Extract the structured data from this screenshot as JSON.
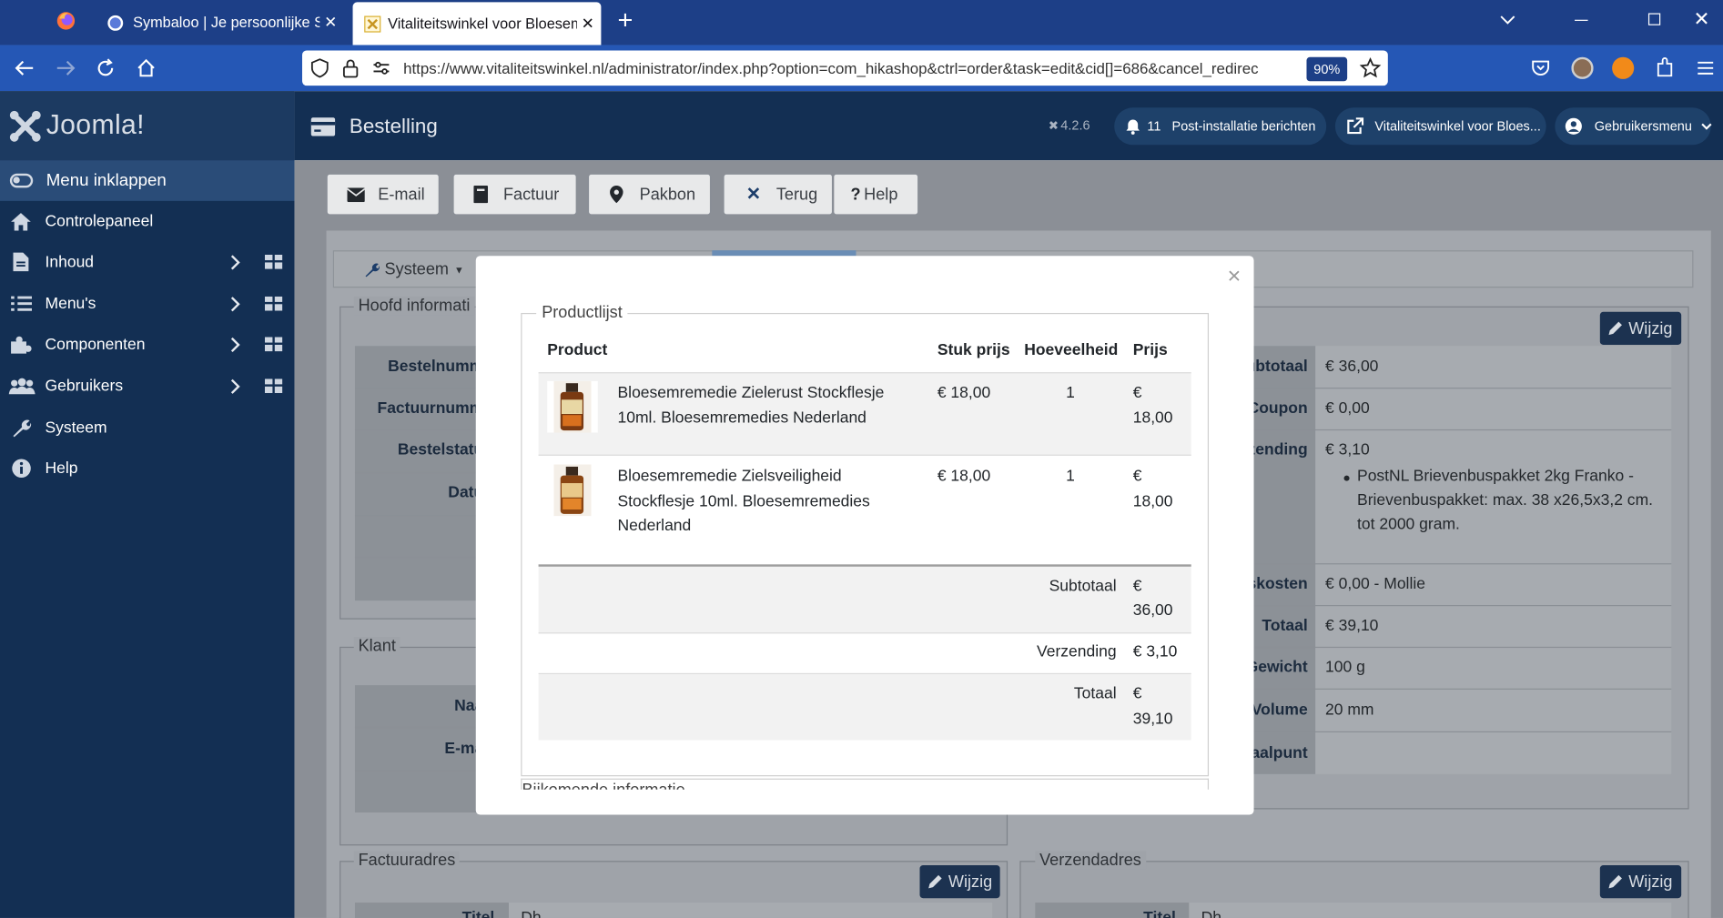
{
  "browser": {
    "tabs": [
      {
        "label": "Symbaloo | Je persoonlijke Start"
      },
      {
        "label": "Vitaliteitswinkel voor Bloesemre"
      }
    ],
    "url": "https://www.vitaliteitswinkel.nl/administrator/index.php?option=com_hikashop&ctrl=order&task=edit&cid[]=686&cancel_redirec",
    "zoom": "90%"
  },
  "joomla": {
    "brand": "Joomla!",
    "page_title": "Bestelling",
    "version": "4.2.6",
    "post_install_count": "11",
    "post_install_label": "Post-installatie berichten",
    "site_link": "Vitaliteitswinkel voor Bloes...",
    "user_menu": "Gebruikersmenu"
  },
  "sidebar": {
    "collapse": "Menu inklappen",
    "items": [
      {
        "label": "Controlepaneel"
      },
      {
        "label": "Inhoud"
      },
      {
        "label": "Menu's"
      },
      {
        "label": "Componenten"
      },
      {
        "label": "Gebruikers"
      },
      {
        "label": "Systeem"
      },
      {
        "label": "Help"
      }
    ]
  },
  "toolbar": {
    "email": "E-mail",
    "invoice": "Factuur",
    "packing": "Pakbon",
    "back": "Terug",
    "help": "Help"
  },
  "background": {
    "system_tab": "Systeem",
    "main_info_legend": "Hoofd informati",
    "main_info_labels": [
      "Bestelnumm",
      "Factuurnumm",
      "Bestelstatu",
      "Datu"
    ],
    "customer_legend": "Klant",
    "customer_labels": [
      "Naa",
      "E-ma"
    ],
    "billing_legend": "Factuuradres",
    "shipping_legend": "Verzendadres",
    "edit_label": "Wijzig",
    "billing_partial_label": "Titel",
    "billing_partial_value": "Dh",
    "shipping_partial_label": "Titel",
    "shipping_partial_value": "Dh",
    "right_rows": [
      {
        "label": "ubtotaal",
        "value": "€ 36,00"
      },
      {
        "label": "Coupon",
        "value": "€ 0,00"
      },
      {
        "label": "zending",
        "value": "€ 3,10"
      },
      {
        "label": "skosten",
        "value": "€ 0,00 - Mollie"
      },
      {
        "label": "Totaal",
        "value": "€ 39,10"
      },
      {
        "label": "Gewicht",
        "value": "100 g"
      },
      {
        "label": "Volume",
        "value": "20 mm"
      },
      {
        "label": "aalpunt",
        "value": ""
      }
    ],
    "shipping_method": [
      "PostNL Brievenbuspakket 2kg Franko -",
      "Brievenbuspakket: max. 38 x26,5x3,2 cm.",
      "tot 2000 gram."
    ]
  },
  "modal": {
    "legend": "Productlijst",
    "headers": {
      "product": "Product",
      "unit_price": "Stuk prijs",
      "quantity": "Hoeveelheid",
      "price": "Prijs"
    },
    "products": [
      {
        "name_lines": [
          "Bloesemremedie Zielerust Stockflesje",
          "10ml. Bloesemremedies Nederland"
        ],
        "unit_price": "€ 18,00",
        "quantity": "1",
        "price_lines": [
          "€",
          "18,00"
        ]
      },
      {
        "name_lines": [
          "Bloesemremedie Zielsveiligheid",
          "Stockflesje 10ml. Bloesemremedies",
          "Nederland"
        ],
        "unit_price": "€ 18,00",
        "quantity": "1",
        "price_lines": [
          "€",
          "18,00"
        ]
      }
    ],
    "totals": [
      {
        "label": "Subtotaal",
        "value_lines": [
          "€",
          "36,00"
        ]
      },
      {
        "label": "Verzending",
        "value_lines": [
          "€ 3,10"
        ]
      },
      {
        "label": "Totaal",
        "value_lines": [
          "€",
          "39,10"
        ]
      }
    ],
    "next_section": "Bijkomende informatie",
    "close": "×"
  }
}
